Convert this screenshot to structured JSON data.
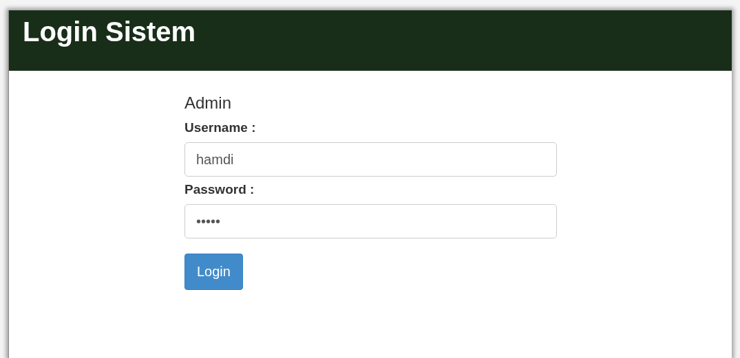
{
  "header": {
    "title": "Login Sistem"
  },
  "form": {
    "heading": "Admin",
    "fields": [
      {
        "label": "Username :",
        "value": "hamdi"
      },
      {
        "label": "Password :",
        "value": "•••••"
      }
    ],
    "button": "Login"
  }
}
